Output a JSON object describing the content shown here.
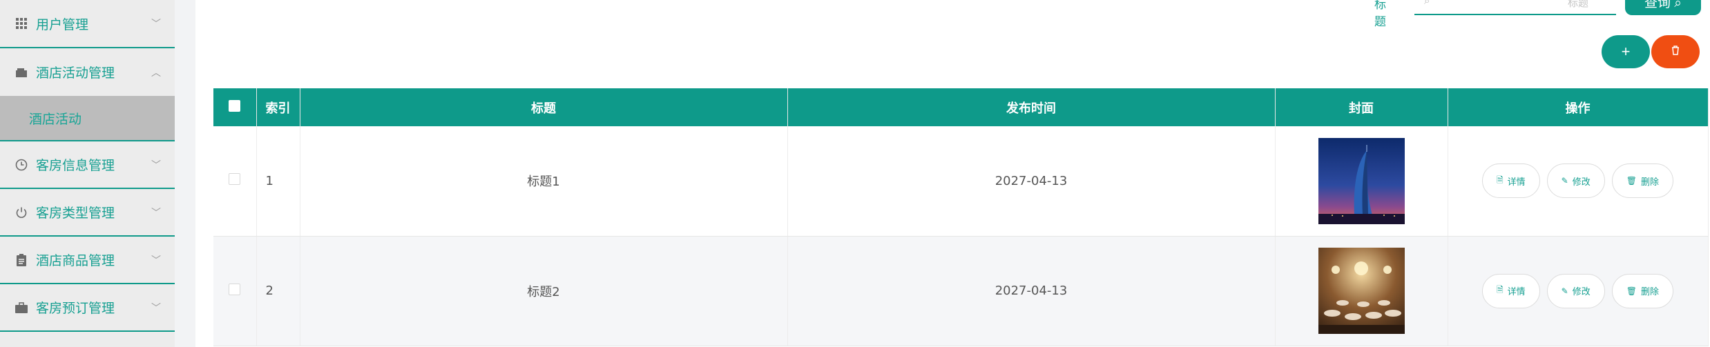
{
  "sidebar": {
    "items": [
      {
        "label": "用户管理",
        "icon": "grid-icon"
      },
      {
        "label": "酒店活动管理",
        "icon": "wallet-icon",
        "expanded": true,
        "children": [
          {
            "label": "酒店活动"
          }
        ]
      },
      {
        "label": "客房信息管理",
        "icon": "clock-icon"
      },
      {
        "label": "客房类型管理",
        "icon": "power-icon"
      },
      {
        "label": "酒店商品管理",
        "icon": "clipboard-icon"
      },
      {
        "label": "客房预订管理",
        "icon": "briefcase-icon"
      }
    ]
  },
  "search": {
    "label": "标题",
    "placeholder": "标题",
    "button_label": "查询 ⌕"
  },
  "actions": {
    "add_label": "+",
    "delete_label": "🗑"
  },
  "table": {
    "headers": [
      "",
      "索引",
      "标题",
      "发布时间",
      "封面",
      "操作"
    ],
    "rows": [
      {
        "index": "1",
        "title": "标题1",
        "date": "2027-04-13",
        "cover": "hotel-tower-night"
      },
      {
        "index": "2",
        "title": "标题2",
        "date": "2027-04-13",
        "cover": "banquet-hall-chandelier"
      }
    ],
    "row_actions": {
      "detail": "详情",
      "edit": "修改",
      "delete": "删除"
    }
  },
  "colors": {
    "primary": "#0e9a8a",
    "danger": "#f04e12"
  }
}
